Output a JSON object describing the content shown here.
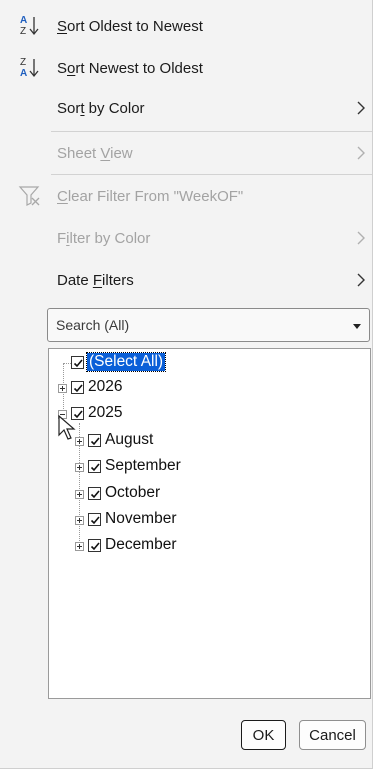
{
  "menu": {
    "items": [
      {
        "label": "Sort Oldest to Newest",
        "icon": "sort-ascending-icon",
        "access_key_index": 0,
        "disabled": false,
        "submenu": false
      },
      {
        "label": "Sort Newest to Oldest",
        "icon": "sort-descending-icon",
        "access_key_index": 1,
        "disabled": false,
        "submenu": false
      },
      {
        "label": "Sort by Color",
        "icon": null,
        "access_key_index": 3,
        "disabled": false,
        "submenu": true
      },
      {
        "label": "Sheet View",
        "icon": null,
        "access_key_index": 6,
        "disabled": true,
        "submenu": true
      },
      {
        "label": "Clear Filter From \"WeekOF\"",
        "icon": "clear-filter-icon",
        "access_key_index": 0,
        "disabled": true,
        "submenu": false
      },
      {
        "label": "Filter by Color",
        "icon": null,
        "access_key_index": 1,
        "disabled": true,
        "submenu": true
      },
      {
        "label": "Date Filters",
        "icon": null,
        "access_key_index": 5,
        "disabled": false,
        "submenu": true
      }
    ]
  },
  "search": {
    "placeholder": "Search (All)"
  },
  "tree": {
    "select_all": "(Select All)",
    "nodes": [
      {
        "label": "2026",
        "checked": true,
        "expanded": false
      },
      {
        "label": "2025",
        "checked": true,
        "expanded": true,
        "children": [
          {
            "label": "August",
            "checked": true
          },
          {
            "label": "September",
            "checked": true
          },
          {
            "label": "October",
            "checked": true
          },
          {
            "label": "November",
            "checked": true
          },
          {
            "label": "December",
            "checked": true
          }
        ]
      }
    ]
  },
  "buttons": {
    "ok": "OK",
    "cancel": "Cancel"
  },
  "colors": {
    "menu_bg": "#f3f3f3",
    "disabled_text": "#a3a3a3",
    "selection": "#0a5fd8"
  }
}
